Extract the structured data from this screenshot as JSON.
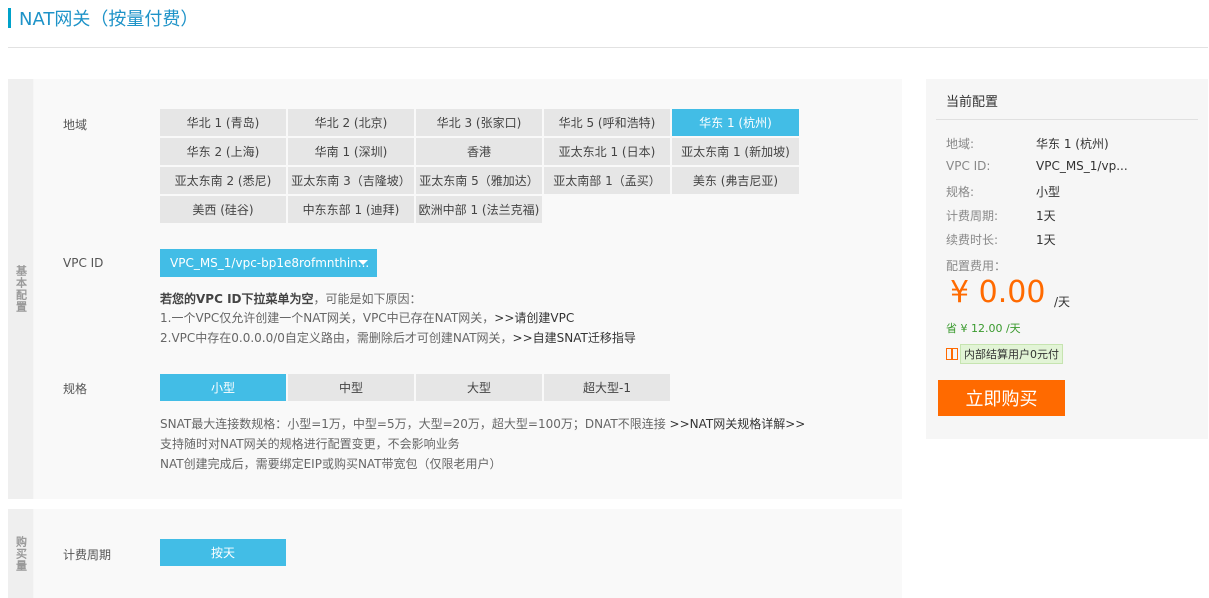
{
  "page": {
    "title": "NAT网关（按量付费）"
  },
  "basic": {
    "side_label": "基本配置",
    "region": {
      "label": "地域",
      "options": [
        "华北 1 (青岛)",
        "华北 2 (北京)",
        "华北 3 (张家口)",
        "华北 5 (呼和浩特)",
        "华东 1 (杭州)",
        "华东 2 (上海)",
        "华南 1 (深圳)",
        "香港",
        "亚太东北 1 (日本)",
        "亚太东南 1 (新加坡)",
        "亚太东南 2 (悉尼)",
        "亚太东南 3（吉隆坡）",
        "亚太东南 5（雅加达）",
        "亚太南部 1（孟买）",
        "美东 (弗吉尼亚)",
        "美西 (硅谷)",
        "中东东部 1 (迪拜)",
        "欧洲中部 1 (法兰克福)"
      ],
      "selected": "华东 1 (杭州)"
    },
    "vpc": {
      "label": "VPC ID",
      "selected": "VPC_MS_1/vpc-bp1e8rofmnthin...",
      "note_title": "若您的VPC ID下拉菜单为空",
      "note_title_suffix": "，可能是如下原因：",
      "note1": "1.一个VPC仅允许创建一个NAT网关，VPC中已存在NAT网关，",
      "note1_link": ">>请创建VPC",
      "note2": "2.VPC中存在0.0.0.0/0自定义路由，需删除后才可创建NAT网关，",
      "note2_link": ">>自建SNAT迁移指导"
    },
    "spec": {
      "label": "规格",
      "options": [
        "小型",
        "中型",
        "大型",
        "超大型-1"
      ],
      "selected": "小型",
      "note1": "SNAT最大连接数规格：小型=1万，中型=5万，大型=20万，超大型=100万；DNAT不限连接 ",
      "note1_link": ">>NAT网关规格详解>>",
      "note2": "支持随时对NAT网关的规格进行配置变更，不会影响业务",
      "note3": "NAT创建完成后，需要绑定EIP或购买NAT带宽包（仅限老用户）"
    }
  },
  "purchase": {
    "side_label": "购买量",
    "billing": {
      "label": "计费周期",
      "option": "按天"
    }
  },
  "summary": {
    "title": "当前配置",
    "items": [
      {
        "key": "地域:",
        "value": "华东 1 (杭州)"
      },
      {
        "key": "VPC ID:",
        "value": "VPC_MS_1/vp..."
      },
      {
        "key": "规格:",
        "value": "小型"
      },
      {
        "key": "计费周期:",
        "value": "1天"
      },
      {
        "key": "续费时长:",
        "value": "1天"
      }
    ],
    "fee_label": "配置费用：",
    "price": "¥ 0.00",
    "price_unit": "/天",
    "saving": "省 ¥ 12.00 /天",
    "promo": "内部结算用户0元付",
    "buy_label": "立即购买"
  },
  "colors": {
    "accent": "#42bde6",
    "buy": "#ff6a00",
    "title": "#1e93c8"
  }
}
